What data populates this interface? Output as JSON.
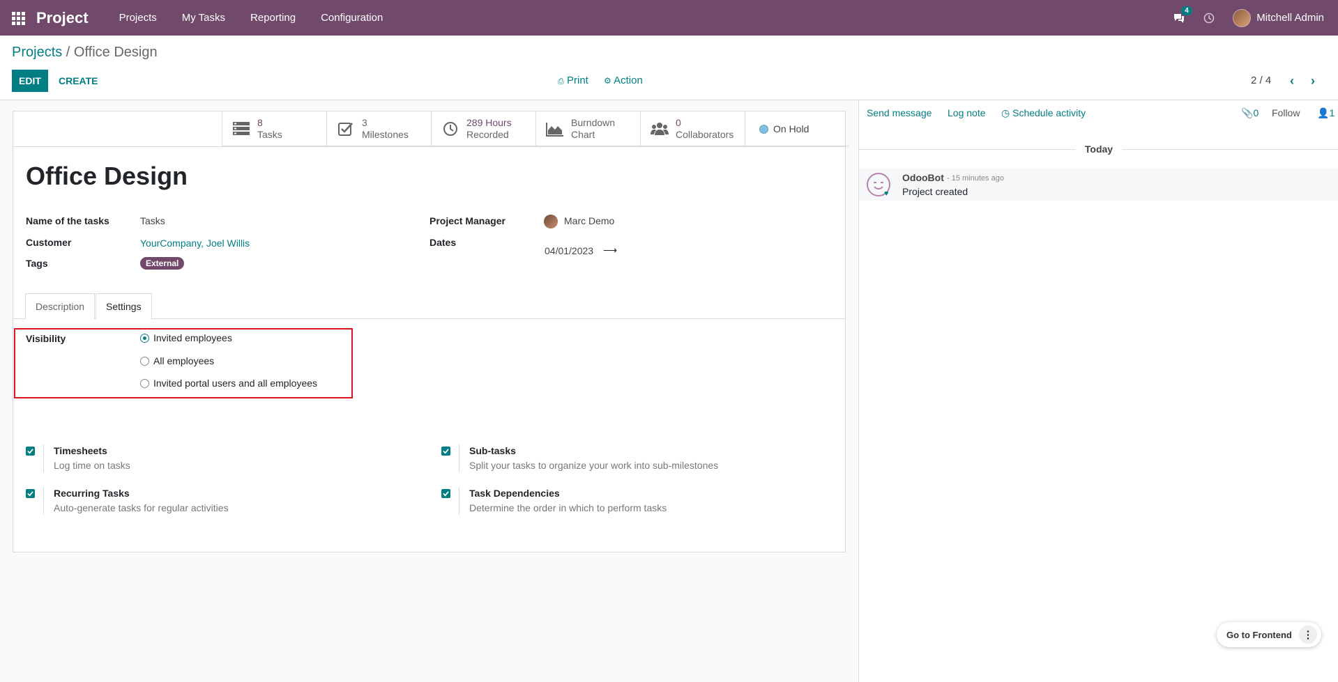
{
  "navbar": {
    "brand": "Project",
    "menu": [
      "Projects",
      "My Tasks",
      "Reporting",
      "Configuration"
    ],
    "messages_badge": "4",
    "user_name": "Mitchell Admin"
  },
  "breadcrumb": {
    "parent": "Projects",
    "separator": " / ",
    "current": "Office Design"
  },
  "control_panel": {
    "edit_label": "EDIT",
    "create_label": "CREATE",
    "print_label": "Print",
    "action_label": "Action",
    "pager": "2 / 4"
  },
  "stat_buttons": [
    {
      "value": "8",
      "label": "Tasks",
      "icon": "tasks-icon"
    },
    {
      "value": "3",
      "label": "Milestones",
      "icon": "check-square-icon"
    },
    {
      "value": "289 Hours",
      "label": "Recorded",
      "icon": "clock-icon"
    },
    {
      "value": "Burndown",
      "label": "Chart",
      "icon": "area-chart-icon"
    },
    {
      "value": "0",
      "label": "Collaborators",
      "icon": "users-icon"
    },
    {
      "value": "On Hold",
      "label": "",
      "icon": "status-dot"
    }
  ],
  "project": {
    "title": "Office Design",
    "fields": {
      "name_of_tasks_label": "Name of the tasks",
      "name_of_tasks": "Tasks",
      "customer_label": "Customer",
      "customer": "YourCompany, Joel Willis",
      "tags_label": "Tags",
      "tag": "External",
      "manager_label": "Project Manager",
      "manager": "Marc Demo",
      "dates_label": "Dates",
      "date_start": "04/01/2023",
      "date_arrow": "⟶"
    }
  },
  "tabs": [
    {
      "label": "Description",
      "active": false
    },
    {
      "label": "Settings",
      "active": true
    }
  ],
  "visibility": {
    "label": "Visibility",
    "options": [
      {
        "label": "Invited employees",
        "checked": true
      },
      {
        "label": "All employees",
        "checked": false
      },
      {
        "label": "Invited portal users and all employees",
        "checked": false
      }
    ]
  },
  "features": [
    {
      "title": "Timesheets",
      "desc": "Log time on tasks",
      "checked": true
    },
    {
      "title": "Sub-tasks",
      "desc": "Split your tasks to organize your work into sub-milestones",
      "checked": true
    },
    {
      "title": "Recurring Tasks",
      "desc": "Auto-generate tasks for regular activities",
      "checked": true
    },
    {
      "title": "Task Dependencies",
      "desc": "Determine the order in which to perform tasks",
      "checked": true
    }
  ],
  "chatter": {
    "send_message": "Send message",
    "log_note": "Log note",
    "schedule_activity": "Schedule activity",
    "attachments_count": "0",
    "follow_label": "Follow",
    "followers_count": "1",
    "date_separator": "Today",
    "messages": [
      {
        "author": "OdooBot",
        "time": "- 15 minutes ago",
        "body": "Project created"
      }
    ]
  },
  "frontend": {
    "label": "Go to Frontend"
  },
  "colors": {
    "brand": "#71496b",
    "accent": "#017e84",
    "highlight": "#e0141e"
  }
}
